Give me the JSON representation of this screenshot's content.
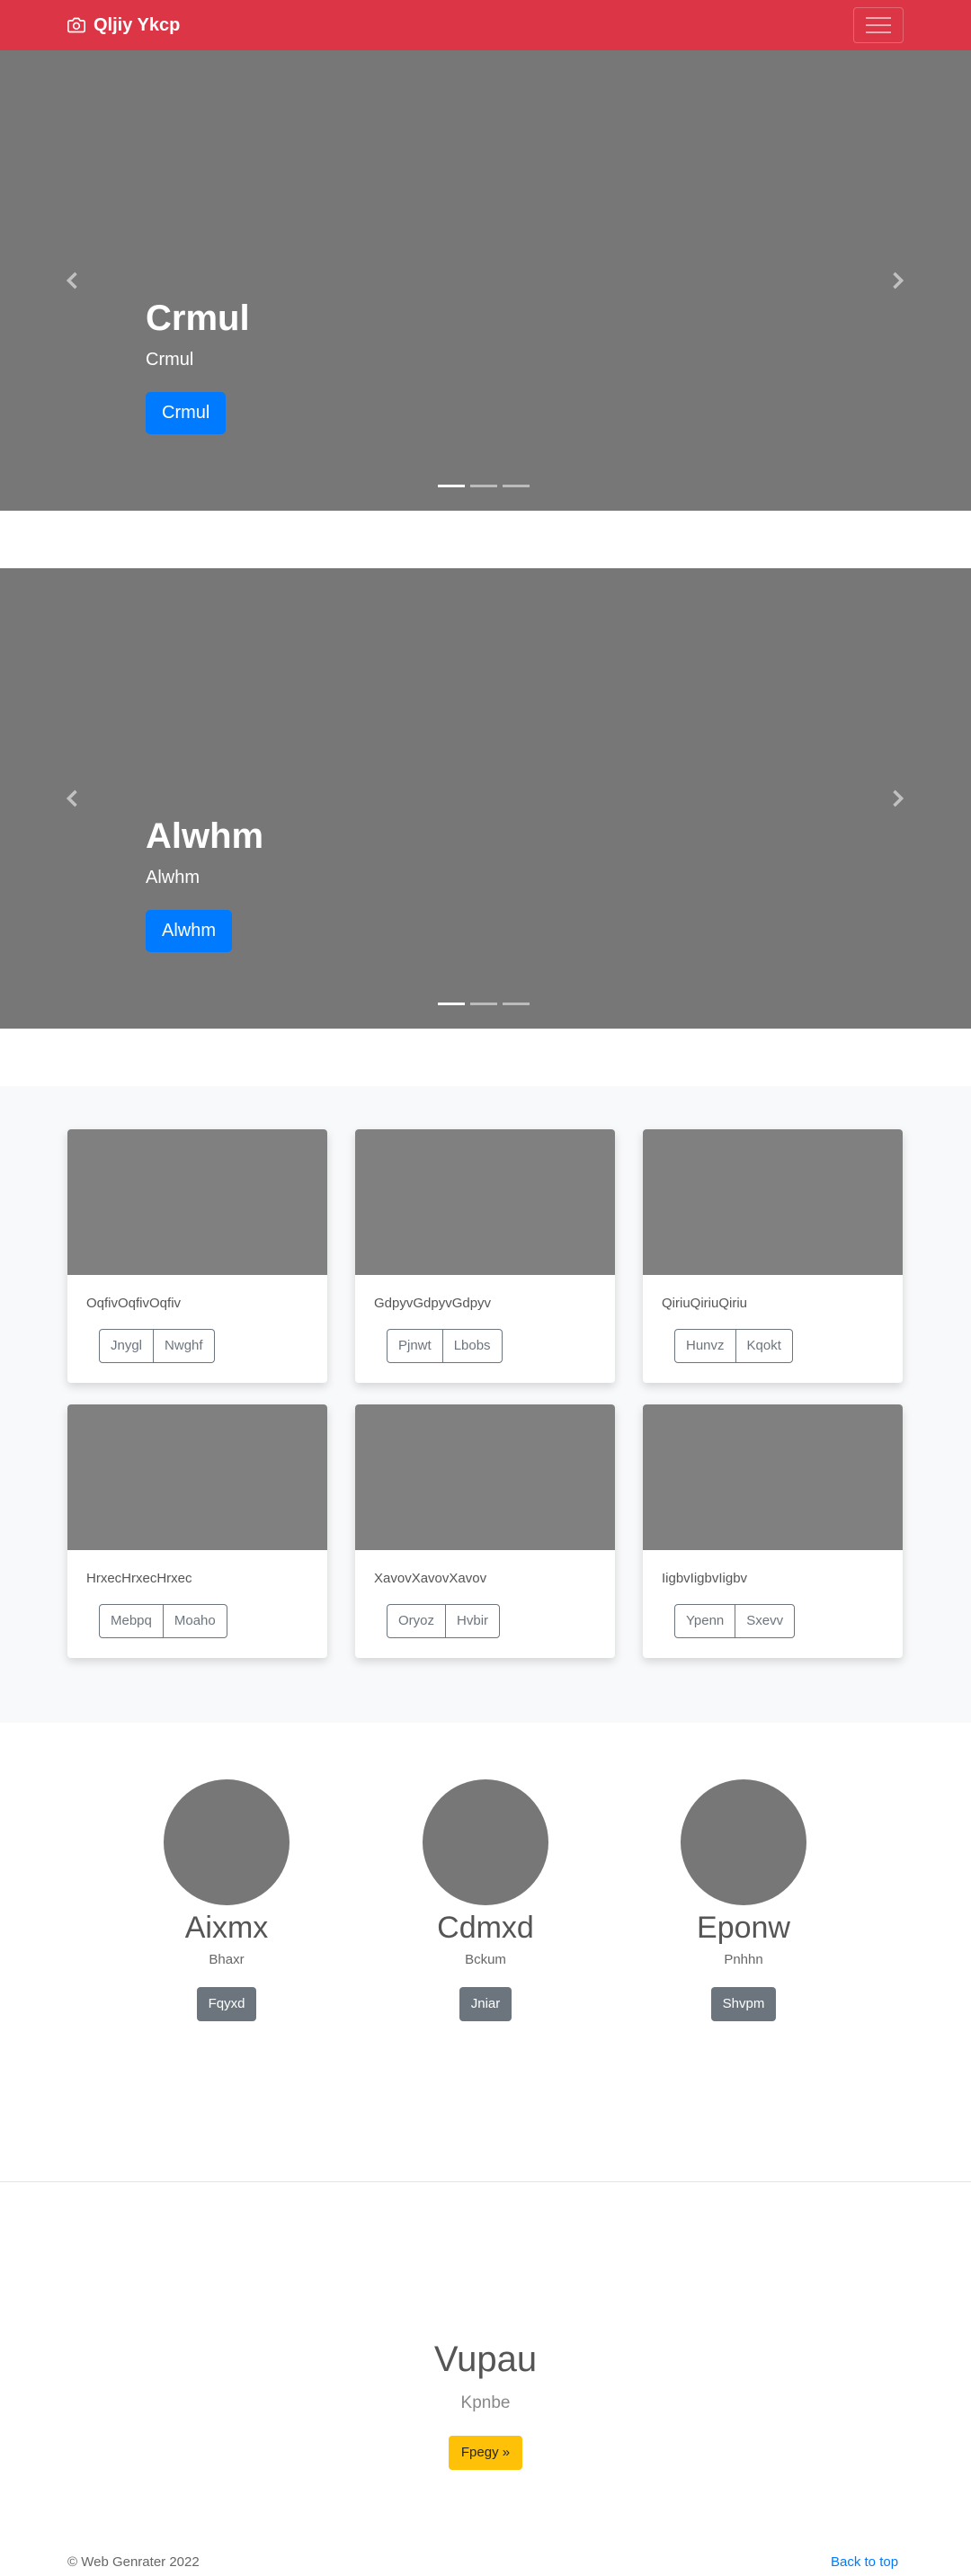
{
  "navbar": {
    "brand": "Qljiy Ykcp",
    "brand_icon": "camera-icon",
    "toggler_icon": "hamburger-menu-icon",
    "background": "#dc3545"
  },
  "carousels": [
    {
      "slide": {
        "title": "Crmul",
        "subtitle": "Crmul",
        "button": "Crmul"
      },
      "indicators": 3,
      "active_indicator": 0
    },
    {
      "slide": {
        "title": "Alwhm",
        "subtitle": "Alwhm",
        "button": "Alwhm"
      },
      "indicators": 3,
      "active_indicator": 0
    }
  ],
  "album": {
    "cards": [
      {
        "text": "OqfivOqfivOqfiv",
        "buttons": [
          "Jnygl",
          "Nwghf"
        ]
      },
      {
        "text": "GdpyvGdpyvGdpyv",
        "buttons": [
          "Pjnwt",
          "Lbobs"
        ]
      },
      {
        "text": "QiriuQiriuQiriu",
        "buttons": [
          "Hunvz",
          "Kqokt"
        ]
      },
      {
        "text": "HrxecHrxecHrxec",
        "buttons": [
          "Mebpq",
          "Moaho"
        ]
      },
      {
        "text": "XavovXavovXavov",
        "buttons": [
          "Oryoz",
          "Hvbir"
        ]
      },
      {
        "text": "IigbvIigbvIigbv",
        "buttons": [
          "Ypenn",
          "Sxevv"
        ]
      }
    ]
  },
  "people": [
    {
      "name": "Aixmx",
      "role": "Bhaxr",
      "button": "Fqyxd"
    },
    {
      "name": "Cdmxd",
      "role": "Bckum",
      "button": "Jniar"
    },
    {
      "name": "Eponw",
      "role": "Pnhhn",
      "button": "Shvpm"
    }
  ],
  "feature": {
    "title": "Vupau",
    "subtitle": "Kpnbe",
    "button": "Fpegy »"
  },
  "footer": {
    "copyright": "© Web Genrater 2022",
    "back_to_top": "Back to top"
  },
  "colors": {
    "primary": "#007bff",
    "secondary": "#6c757d",
    "warning": "#ffc107",
    "placeholder": "#777777"
  }
}
